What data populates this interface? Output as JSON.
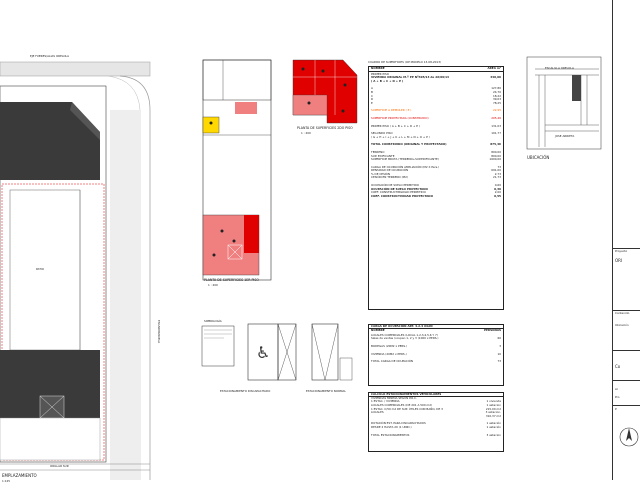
{
  "site_plan": {
    "street_north": "EJE FUERES/ALIAS ORELOLA",
    "street_south": "ORILLAR SUR",
    "street_east": "ESCARMANUELA",
    "patio_label": "PATIO",
    "title": "EMPLAZAMIENTO",
    "scale": "1:125"
  },
  "plan_1": {
    "title": "PLANTA DE SUPERFICIES 1ER PISO",
    "scale": "1 : 200"
  },
  "plan_2": {
    "title": "PLANTA DE SUPERFICIES 2DO PISO",
    "scale": "1 : 200"
  },
  "surface_table": {
    "header": "CUADRO DE SUPERFICIES (OP MODELO 13-08-2013)",
    "col_name": "NOMBRE",
    "col_area": "AREA m²",
    "rows": [
      {
        "label": "PRIMER PISO",
        "value": "",
        "style": ""
      },
      {
        "label": "VIVIENDA ORIGINAL M.º PP Nº305/13 de 26/09/13",
        "value": "340,00",
        "style": "bold"
      },
      {
        "label": "( A + B + C + D + E )",
        "value": "",
        "style": "bold"
      },
      {
        "label": "A",
        "value": "127,80",
        "style": ""
      },
      {
        "label": "B",
        "value": "24,70",
        "style": ""
      },
      {
        "label": "C",
        "value": "18,22",
        "style": ""
      },
      {
        "label": "D",
        "value": "39,03",
        "style": ""
      },
      {
        "label": "E",
        "value": "78,25",
        "style": ""
      },
      {
        "label": "SUPERFICIE A DEMOLER ( E )",
        "value": "22,95",
        "style": "orange"
      },
      {
        "label": "SUPERFICIE PROYECTADA (CONSTRUIDO)",
        "value": "205,46",
        "style": "red"
      },
      {
        "label": "PRIMER PISO ( A + B + C + D + E )",
        "value": "131,03",
        "style": ""
      },
      {
        "label": "SEGUNDO PISO",
        "value": "101,77",
        "style": ""
      },
      {
        "label": "( G + H + I + J + K + L + M + N + O + P )",
        "value": "",
        "style": ""
      },
      {
        "label": "TOTAL CONSTRUIDO (ORIGINAL Y PROYECTADO)",
        "value": "875,46",
        "style": "bold"
      },
      {
        "label": "TERRENO",
        "value": "800,00",
        "style": ""
      },
      {
        "label": "SUP. EDIFICANTE",
        "value": "800,00",
        "style": ""
      },
      {
        "label": "SUPERFICIE BRUTA (TERRENO+SUP.EDIFICANTE)",
        "value": "1600,00",
        "style": ""
      },
      {
        "label": "CARGA DE OCUPACIÓN AMPLIACIÓN (M2 X Pers.)",
        "value": "73",
        "style": ""
      },
      {
        "label": "DENSIDAD DE OCUPACIÓN",
        "value": "691,00",
        "style": ""
      },
      {
        "label": "% DE CESIÓN",
        "value": "2,73",
        "style": ""
      },
      {
        "label": "CESIÓN EN TERRENO (M2)",
        "value": "21,73",
        "style": ""
      },
      {
        "label": "OCUPACIÓN DE SUELO PERMITIDO",
        "value": "0,60",
        "style": ""
      },
      {
        "label": "OCUPACIÓN DE SUELO PROYECTADO",
        "value": "0,39",
        "style": "bold"
      },
      {
        "label": "COEF. CONSTRUCTIBILIDAD PERMITIDO",
        "value": "2,00",
        "style": ""
      },
      {
        "label": "COEF. CONSTRUCTIVIDAD PROYECTADO",
        "value": "0,55",
        "style": "bold"
      }
    ]
  },
  "occupancy_table": {
    "header": "CARGA DE OCUPACIÓN ART. 4.2.4 OGUC",
    "col_name": "NOMBRE",
    "col_value": "PERSONAS",
    "rows": [
      {
        "label": "LOCALES COMERCIALES (LOCAL 1,2,3,4,5,6 Y 7)",
        "value": ""
      },
      {
        "label": "Salas de ventas (ocupan 1, 2 y 3 (1000 x PERS.)",
        "value": "60"
      },
      {
        "label": "BODEGAS (20M2 x PERS.)",
        "value": "3"
      },
      {
        "label": "VIVIENDA (20M2 x PERS.)",
        "value": "10"
      },
      {
        "label": "TOTAL CARGA DE OCUPACIÓN",
        "value": "73"
      }
    ]
  },
  "parking_table": {
    "header": "CÁLCULO ESTACIONAMIENTOS VEHICULARES",
    "subheader": "VIVIENDAS MÍNIMA SEGÚN P.R.C.",
    "rows": [
      {
        "label": "1 ESTAC. / VIVIENDA",
        "value": "1 vivienda"
      },
      {
        "label": "LOCALES COMERCIALES (DE 201 A 500 m2)",
        "value": "1 estacion"
      },
      {
        "label": "1 ESTAC. C/50 m2 DE SUP. ÚTILES CON BAÑO, DE 3",
        "value": "215,00 m2"
      },
      {
        "label": "LOCALES",
        "value": "3 estacion."
      },
      {
        "label": "",
        "value": "310,37 m2"
      },
      {
        "label": "DOTACIÓN EST. PARA DISCAPACITADOS",
        "value": "1 estación"
      },
      {
        "label": "DESDE 2 HASTA 20 (1 UNID.)",
        "value": "1 estación"
      },
      {
        "label": "TOTAL ESTACIONAMIENTOS",
        "value": "3 estacion"
      }
    ]
  },
  "location": {
    "title": "UBICACIÓN",
    "street_1": "ESCALILLA ORELOLA",
    "street_2": "JOSE ARRIETA",
    "street_3": "ESCARMANUELA"
  },
  "details": {
    "note_1": "ESTACIONAMIENTO DISCAPACITADO",
    "note_2": "ESTACIONAMIENTO NORMAL",
    "legend": "SIMBOLOGÍA"
  },
  "title_block": {
    "field_1": "Proyecto",
    "field_2": "ORI",
    "field_3": "Contenido",
    "field_4": "Ubicación",
    "field_5": "Co",
    "field_6": "Ar",
    "field_7": "Pro",
    "field_8": "P"
  },
  "colors": {
    "red": "#e00000",
    "salmon": "#f08080",
    "yellow": "#ffd800",
    "dark": "#3a3a3a",
    "gray": "#aaaaaa"
  }
}
